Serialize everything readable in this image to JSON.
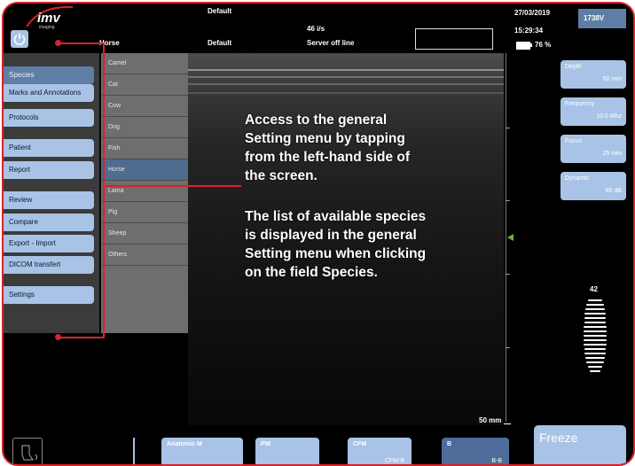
{
  "header": {
    "brand": "imv",
    "brand_sub": "imaging",
    "preset_top": "Default",
    "species_field": "Horse",
    "preset_field": "Default",
    "frame_rate": "46 i/s",
    "server_status": "Server off line",
    "date": "27/03/2019",
    "time": "15:29:34",
    "battery": "76 %",
    "probe": "1738V"
  },
  "left_menu": {
    "items": [
      {
        "label": "Species"
      },
      {
        "label": "Marks and Annotations"
      },
      {
        "label": "Protocols"
      },
      {
        "label": "Patient"
      },
      {
        "label": "Report"
      },
      {
        "label": "Review"
      },
      {
        "label": "Compare"
      },
      {
        "label": "Export - Import"
      },
      {
        "label": "DICOM transfert"
      },
      {
        "label": "Settings"
      }
    ]
  },
  "species_list": {
    "items": [
      "Camel",
      "Cat",
      "Cow",
      "Dog",
      "Fish",
      "Horse",
      "Lama",
      "Pig",
      "Sheep",
      "Others"
    ],
    "selected": "Horse"
  },
  "right_panel": {
    "depth": {
      "label": "Depth",
      "value": "50 mm"
    },
    "frequency": {
      "label": "Frequency",
      "value": "10.0 Mhz"
    },
    "focus": {
      "label": "Focus",
      "value": "25 mm"
    },
    "dynamic": {
      "label": "Dynamic",
      "value": "85 dB"
    },
    "gain_value": "42"
  },
  "depth_scale_label": "50 mm",
  "annotation": {
    "line1": "Access to the general",
    "line2": "Setting menu by tapping",
    "line3": "from the left-hand side of",
    "line4": "the screen.",
    "line5": "The list of available species",
    "line6": "is displayed in the general",
    "line7": "Setting menu when clicking",
    "line8": "on the field Species."
  },
  "bottom_bar": {
    "anatomic_m": "Anatomic M",
    "pw": "PW",
    "cfm": "CFM",
    "cfm_sub": "CFM-B",
    "b": "B",
    "b_sub": "B-B",
    "freeze": "Freeze"
  },
  "colors": {
    "accent_red": "#d8232a",
    "button_blue": "#a8c3e6",
    "selected_blue": "#5f7ea6"
  },
  "icons": {
    "power": "power-icon",
    "probe": "probe-icon",
    "battery": "battery-icon"
  }
}
